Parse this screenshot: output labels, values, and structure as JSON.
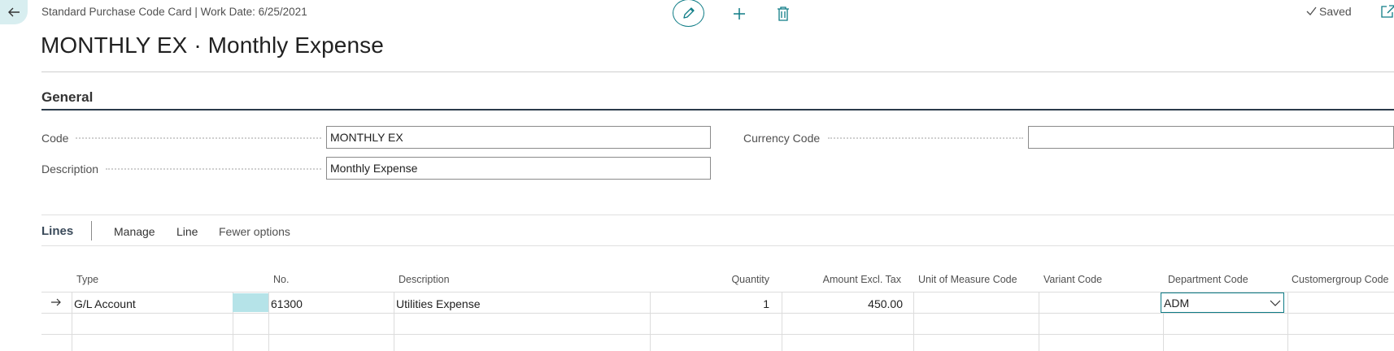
{
  "header": {
    "breadcrumb": "Standard Purchase Code Card | Work Date: 6/25/2021",
    "status": "Saved",
    "icons": {
      "back": "arrow-left-icon",
      "edit": "pencil-icon",
      "new": "plus-icon",
      "delete": "trash-icon",
      "saved": "checkmark-icon",
      "popout": "open-new-window-icon"
    }
  },
  "page": {
    "title": "MONTHLY EX · Monthly Expense"
  },
  "general": {
    "title": "General",
    "fields": {
      "code": {
        "label": "Code",
        "value": "MONTHLY EX"
      },
      "description": {
        "label": "Description",
        "value": "Monthly Expense"
      },
      "currency_code": {
        "label": "Currency Code",
        "value": ""
      }
    }
  },
  "lines": {
    "title": "Lines",
    "actions": [
      "Manage",
      "Line",
      "Fewer options"
    ],
    "columns": [
      "Type",
      "No.",
      "Description",
      "Quantity",
      "Amount Excl. Tax",
      "Unit of Measure Code",
      "Variant Code",
      "Department Code",
      "Customergroup Code"
    ],
    "rows": [
      {
        "type": "G/L Account",
        "no": "61300",
        "description": "Utilities Expense",
        "quantity": "1",
        "amount_excl_tax": "450.00",
        "unit_of_measure_code": "",
        "variant_code": "",
        "department_code": "ADM",
        "customergroup_code": ""
      }
    ]
  },
  "colors": {
    "accent": "#0e7c86",
    "selected_cell": "#b5e3e8",
    "back_button_bg": "#d8eef0"
  }
}
